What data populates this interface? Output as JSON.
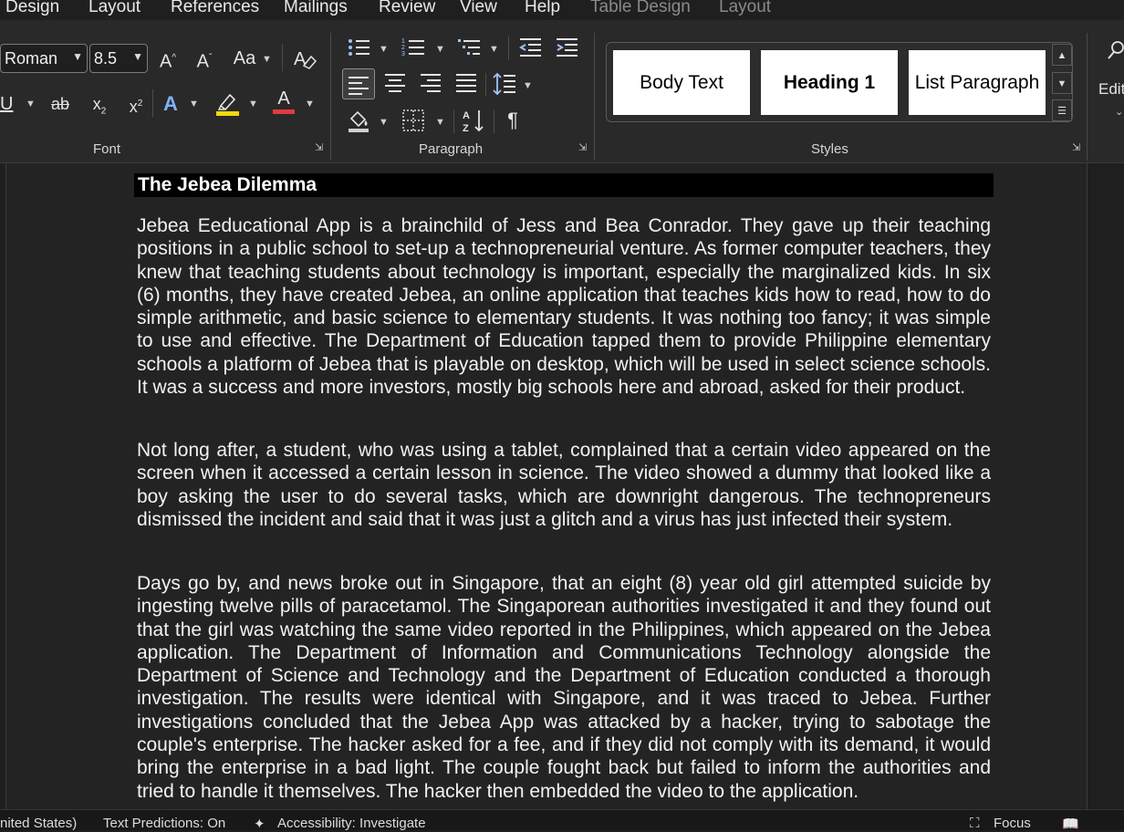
{
  "menu": {
    "tabs": [
      "Design",
      "Layout",
      "References",
      "Mailings",
      "Review",
      "View",
      "Help"
    ],
    "context_tabs": [
      "Table Design",
      "Layout"
    ]
  },
  "font_group": {
    "label": "Font",
    "font_name": "Roman",
    "font_size": "8.5",
    "grow_label": "A",
    "shrink_label": "A",
    "case_label": "Aa",
    "underline_label": "U",
    "strike_label": "ab",
    "subscript_label": "x",
    "subscript_mark": "2",
    "superscript_label": "x",
    "superscript_mark": "2",
    "effects_label": "A",
    "font_color_label": "A",
    "highlight_color": "#f5d90a",
    "font_color": "#e23a3a"
  },
  "paragraph_group": {
    "label": "Paragraph",
    "pilcrow": "¶"
  },
  "styles_group": {
    "label": "Styles",
    "styles": [
      "Body Text",
      "Heading 1",
      "List Paragraph"
    ]
  },
  "editing_group": {
    "label": "Edit"
  },
  "document": {
    "heading": "The Jebea Dilemma",
    "paragraphs": [
      "Jebea Eeducational App   is a brainchild of Jess and Bea Conrador. They gave up their teaching positions in a public school to set-up a technopreneurial venture. As former computer teachers, they knew that teaching students about technology is important, especially the marginalized kids. In six (6) months, they have created Jebea, an online application that teaches kids how to read, how to do simple arithmetic, and basic science to elementary students. It was nothing too fancy; it was simple to use and effective. The Department of Education tapped them to provide Philippine elementary schools a platform of Jebea that is playable on desktop, which will be used in select science schools. It was a success and more investors, mostly big schools here and abroad, asked for their product.",
      "Not long after, a student, who was using a tablet, complained that a certain video appeared on the screen when it accessed a certain lesson in science. The video showed a dummy that looked like a boy asking the user to do several tasks, which are downright dangerous. The technopreneurs dismissed the incident and said that it was just a glitch and a virus has just infected their system.",
      "Days go by, and news broke out in Singapore, that an eight (8) year old girl attempted suicide by ingesting twelve pills of paracetamol. The Singaporean authorities investigated it and they found out that the girl was watching the same video reported in the Philippines, which appeared on the Jebea application. The Department of Information and Communications Technology alongside the Department of Science and Technology and the Department of Education conducted a thorough investigation. The results were identical with Singapore, and it was traced to Jebea. Further investigations concluded that the Jebea App was attacked by a hacker, trying to sabotage the couple's enterprise. The hacker asked for a fee, and if they did not comply with its demand, it would bring the enterprise in a bad light. The couple fought back but failed to inform the authorities and tried to handle it themselves. The hacker then embedded the video to the application."
    ]
  },
  "status": {
    "language": "nited States)",
    "text_predictions": "Text Predictions: On",
    "accessibility": "Accessibility: Investigate",
    "focus": "Focus"
  }
}
